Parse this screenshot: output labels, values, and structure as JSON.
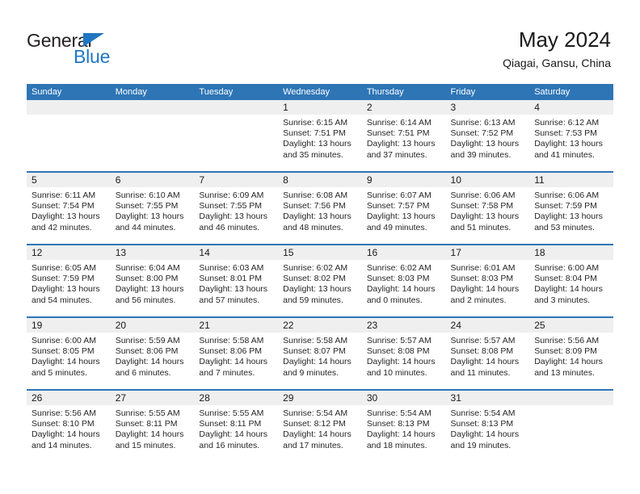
{
  "brand": {
    "name_top": "General",
    "name_bottom": "Blue",
    "accent_color": "#1f77c2",
    "triangle_icon": "triangle-icon"
  },
  "header": {
    "title": "May 2024",
    "subtitle": "Qiagai, Gansu, China"
  },
  "colors": {
    "header_bar": "#2E75B6",
    "daynum_band": "#EFEFEF",
    "week_separator": "#2E75B6",
    "text": "#262626"
  },
  "weekdays": [
    "Sunday",
    "Monday",
    "Tuesday",
    "Wednesday",
    "Thursday",
    "Friday",
    "Saturday"
  ],
  "weeks": [
    [
      {
        "day": "",
        "sunrise": "",
        "sunset": "",
        "daylight_line1": "",
        "daylight_line2": ""
      },
      {
        "day": "",
        "sunrise": "",
        "sunset": "",
        "daylight_line1": "",
        "daylight_line2": ""
      },
      {
        "day": "",
        "sunrise": "",
        "sunset": "",
        "daylight_line1": "",
        "daylight_line2": ""
      },
      {
        "day": "1",
        "sunrise": "Sunrise: 6:15 AM",
        "sunset": "Sunset: 7:51 PM",
        "daylight_line1": "Daylight: 13 hours",
        "daylight_line2": "and 35 minutes."
      },
      {
        "day": "2",
        "sunrise": "Sunrise: 6:14 AM",
        "sunset": "Sunset: 7:51 PM",
        "daylight_line1": "Daylight: 13 hours",
        "daylight_line2": "and 37 minutes."
      },
      {
        "day": "3",
        "sunrise": "Sunrise: 6:13 AM",
        "sunset": "Sunset: 7:52 PM",
        "daylight_line1": "Daylight: 13 hours",
        "daylight_line2": "and 39 minutes."
      },
      {
        "day": "4",
        "sunrise": "Sunrise: 6:12 AM",
        "sunset": "Sunset: 7:53 PM",
        "daylight_line1": "Daylight: 13 hours",
        "daylight_line2": "and 41 minutes."
      }
    ],
    [
      {
        "day": "5",
        "sunrise": "Sunrise: 6:11 AM",
        "sunset": "Sunset: 7:54 PM",
        "daylight_line1": "Daylight: 13 hours",
        "daylight_line2": "and 42 minutes."
      },
      {
        "day": "6",
        "sunrise": "Sunrise: 6:10 AM",
        "sunset": "Sunset: 7:55 PM",
        "daylight_line1": "Daylight: 13 hours",
        "daylight_line2": "and 44 minutes."
      },
      {
        "day": "7",
        "sunrise": "Sunrise: 6:09 AM",
        "sunset": "Sunset: 7:55 PM",
        "daylight_line1": "Daylight: 13 hours",
        "daylight_line2": "and 46 minutes."
      },
      {
        "day": "8",
        "sunrise": "Sunrise: 6:08 AM",
        "sunset": "Sunset: 7:56 PM",
        "daylight_line1": "Daylight: 13 hours",
        "daylight_line2": "and 48 minutes."
      },
      {
        "day": "9",
        "sunrise": "Sunrise: 6:07 AM",
        "sunset": "Sunset: 7:57 PM",
        "daylight_line1": "Daylight: 13 hours",
        "daylight_line2": "and 49 minutes."
      },
      {
        "day": "10",
        "sunrise": "Sunrise: 6:06 AM",
        "sunset": "Sunset: 7:58 PM",
        "daylight_line1": "Daylight: 13 hours",
        "daylight_line2": "and 51 minutes."
      },
      {
        "day": "11",
        "sunrise": "Sunrise: 6:06 AM",
        "sunset": "Sunset: 7:59 PM",
        "daylight_line1": "Daylight: 13 hours",
        "daylight_line2": "and 53 minutes."
      }
    ],
    [
      {
        "day": "12",
        "sunrise": "Sunrise: 6:05 AM",
        "sunset": "Sunset: 7:59 PM",
        "daylight_line1": "Daylight: 13 hours",
        "daylight_line2": "and 54 minutes."
      },
      {
        "day": "13",
        "sunrise": "Sunrise: 6:04 AM",
        "sunset": "Sunset: 8:00 PM",
        "daylight_line1": "Daylight: 13 hours",
        "daylight_line2": "and 56 minutes."
      },
      {
        "day": "14",
        "sunrise": "Sunrise: 6:03 AM",
        "sunset": "Sunset: 8:01 PM",
        "daylight_line1": "Daylight: 13 hours",
        "daylight_line2": "and 57 minutes."
      },
      {
        "day": "15",
        "sunrise": "Sunrise: 6:02 AM",
        "sunset": "Sunset: 8:02 PM",
        "daylight_line1": "Daylight: 13 hours",
        "daylight_line2": "and 59 minutes."
      },
      {
        "day": "16",
        "sunrise": "Sunrise: 6:02 AM",
        "sunset": "Sunset: 8:03 PM",
        "daylight_line1": "Daylight: 14 hours",
        "daylight_line2": "and 0 minutes."
      },
      {
        "day": "17",
        "sunrise": "Sunrise: 6:01 AM",
        "sunset": "Sunset: 8:03 PM",
        "daylight_line1": "Daylight: 14 hours",
        "daylight_line2": "and 2 minutes."
      },
      {
        "day": "18",
        "sunrise": "Sunrise: 6:00 AM",
        "sunset": "Sunset: 8:04 PM",
        "daylight_line1": "Daylight: 14 hours",
        "daylight_line2": "and 3 minutes."
      }
    ],
    [
      {
        "day": "19",
        "sunrise": "Sunrise: 6:00 AM",
        "sunset": "Sunset: 8:05 PM",
        "daylight_line1": "Daylight: 14 hours",
        "daylight_line2": "and 5 minutes."
      },
      {
        "day": "20",
        "sunrise": "Sunrise: 5:59 AM",
        "sunset": "Sunset: 8:06 PM",
        "daylight_line1": "Daylight: 14 hours",
        "daylight_line2": "and 6 minutes."
      },
      {
        "day": "21",
        "sunrise": "Sunrise: 5:58 AM",
        "sunset": "Sunset: 8:06 PM",
        "daylight_line1": "Daylight: 14 hours",
        "daylight_line2": "and 7 minutes."
      },
      {
        "day": "22",
        "sunrise": "Sunrise: 5:58 AM",
        "sunset": "Sunset: 8:07 PM",
        "daylight_line1": "Daylight: 14 hours",
        "daylight_line2": "and 9 minutes."
      },
      {
        "day": "23",
        "sunrise": "Sunrise: 5:57 AM",
        "sunset": "Sunset: 8:08 PM",
        "daylight_line1": "Daylight: 14 hours",
        "daylight_line2": "and 10 minutes."
      },
      {
        "day": "24",
        "sunrise": "Sunrise: 5:57 AM",
        "sunset": "Sunset: 8:08 PM",
        "daylight_line1": "Daylight: 14 hours",
        "daylight_line2": "and 11 minutes."
      },
      {
        "day": "25",
        "sunrise": "Sunrise: 5:56 AM",
        "sunset": "Sunset: 8:09 PM",
        "daylight_line1": "Daylight: 14 hours",
        "daylight_line2": "and 13 minutes."
      }
    ],
    [
      {
        "day": "26",
        "sunrise": "Sunrise: 5:56 AM",
        "sunset": "Sunset: 8:10 PM",
        "daylight_line1": "Daylight: 14 hours",
        "daylight_line2": "and 14 minutes."
      },
      {
        "day": "27",
        "sunrise": "Sunrise: 5:55 AM",
        "sunset": "Sunset: 8:11 PM",
        "daylight_line1": "Daylight: 14 hours",
        "daylight_line2": "and 15 minutes."
      },
      {
        "day": "28",
        "sunrise": "Sunrise: 5:55 AM",
        "sunset": "Sunset: 8:11 PM",
        "daylight_line1": "Daylight: 14 hours",
        "daylight_line2": "and 16 minutes."
      },
      {
        "day": "29",
        "sunrise": "Sunrise: 5:54 AM",
        "sunset": "Sunset: 8:12 PM",
        "daylight_line1": "Daylight: 14 hours",
        "daylight_line2": "and 17 minutes."
      },
      {
        "day": "30",
        "sunrise": "Sunrise: 5:54 AM",
        "sunset": "Sunset: 8:13 PM",
        "daylight_line1": "Daylight: 14 hours",
        "daylight_line2": "and 18 minutes."
      },
      {
        "day": "31",
        "sunrise": "Sunrise: 5:54 AM",
        "sunset": "Sunset: 8:13 PM",
        "daylight_line1": "Daylight: 14 hours",
        "daylight_line2": "and 19 minutes."
      },
      {
        "day": "",
        "sunrise": "",
        "sunset": "",
        "daylight_line1": "",
        "daylight_line2": ""
      }
    ]
  ]
}
